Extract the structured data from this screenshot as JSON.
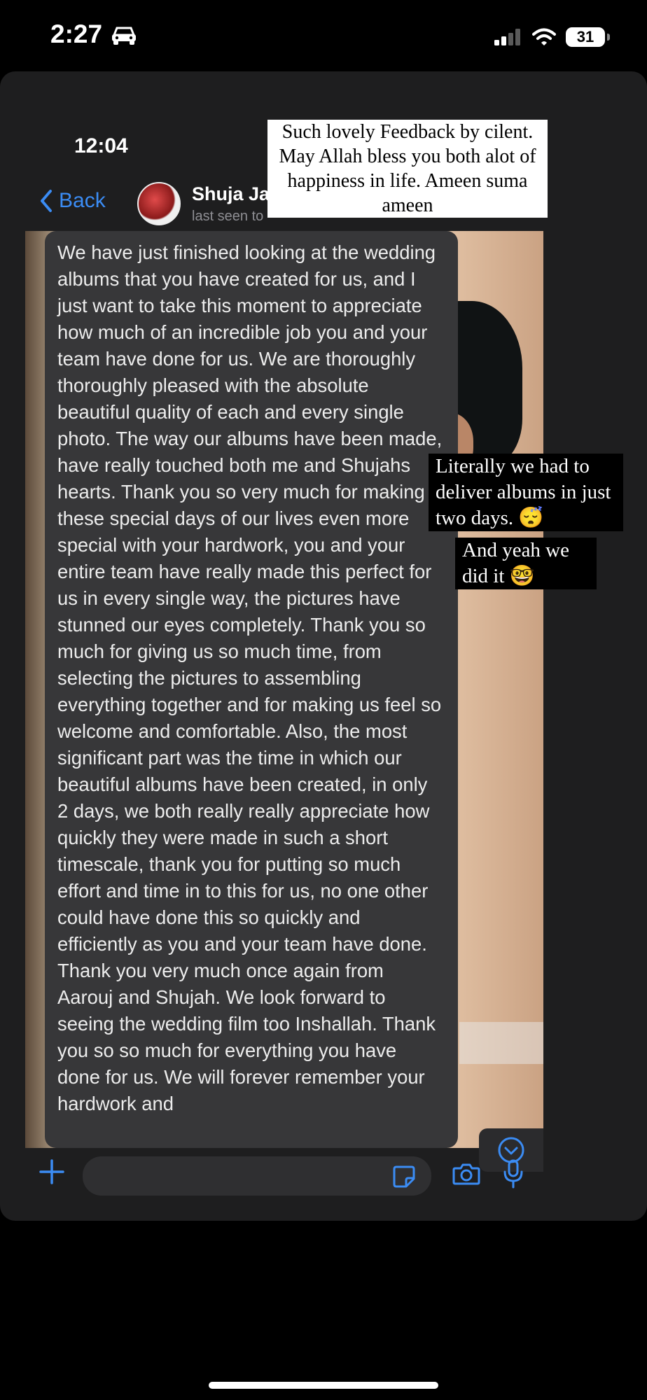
{
  "status_bar": {
    "time": "2:27",
    "battery": "31"
  },
  "chat_header": {
    "time": "12:04",
    "back_label": "Back",
    "contact_name": "Shuja Ja",
    "contact_status": "last seen to"
  },
  "message": {
    "text": "We have just finished looking at the wedding albums that you have created for us, and I just want to take this moment to appreciate how much of an incredible job you and your team have done for us. We are thoroughly thoroughly pleased with the absolute beautiful quality of each and every single photo. The way our albums have been made, have really touched both me and Shujahs hearts. Thank you so very much for making these special days of our lives even more special with your hardwork, you and your entire team have really made this perfect for us in every single way, the pictures have stunned our eyes completely. Thank you so much for giving us so much time, from selecting the pictures to assembling everything together and for making us feel so welcome and comfortable. Also, the most significant part was the time in which our beautiful albums have been created, in only 2 days, we both really really appreciate how quickly they were made in such a short timescale, thank you for putting so much effort and time in to this for us, no one other could have done this so quickly and efficiently as you and your team have done. Thank you very much once again from Aarouj and Shujah. We look forward to seeing the wedding film too Inshallah. Thank you so so much for everything you have done for us. We will forever remember your hardwork and"
  },
  "overlays": {
    "caption_top": "Such lovely Feedback by cilent. May Allah bless you both alot of happiness in life. Ameen suma ameen",
    "caption_mid": "Literally we had to deliver albums in just two days. 😴",
    "caption_low": "And yeah we did it 🤓"
  },
  "input_bar": {
    "placeholder": ""
  },
  "colors": {
    "accent": "#3b8cf4",
    "bubble": "#373739",
    "background": "#1e1e1f"
  },
  "icons": [
    "car-icon",
    "signal-icon",
    "wifi-icon",
    "battery-icon",
    "chevron-left-icon",
    "chevron-down-circle-icon",
    "plus-icon",
    "sticker-icon",
    "camera-icon",
    "microphone-icon"
  ]
}
